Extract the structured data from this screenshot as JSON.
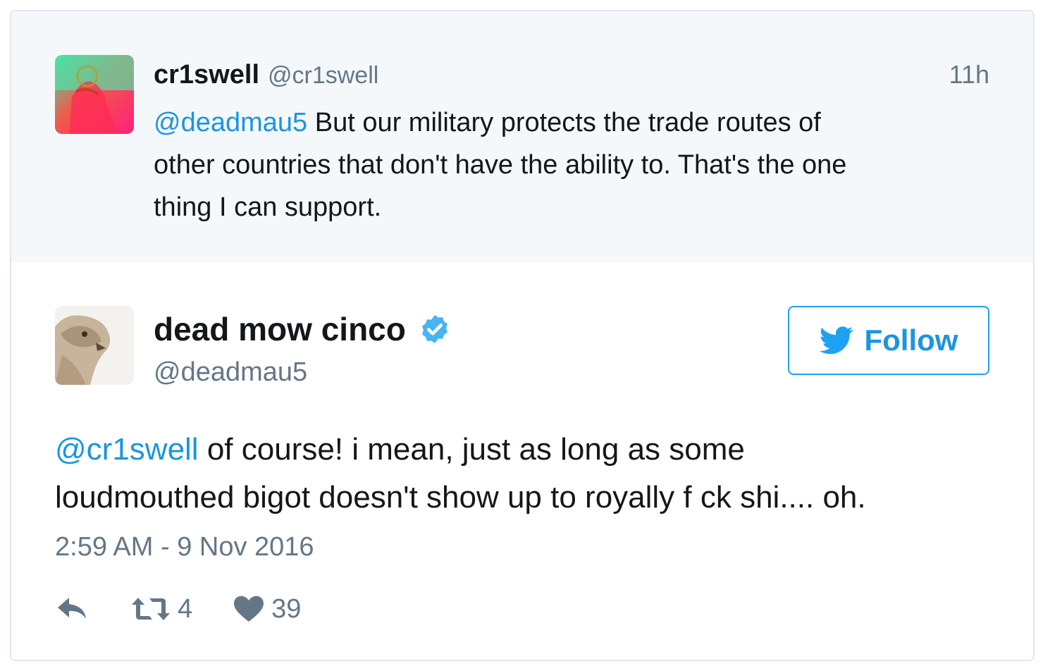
{
  "parent_tweet": {
    "display_name": "cr1swell",
    "handle": "@cr1swell",
    "time": "11h",
    "mention": "@deadmau5",
    "text_line1": " But our military protects the trade routes of",
    "text_line2": "other countries that don't have the ability to. That's the one",
    "text_line3": "thing I can support."
  },
  "tweet": {
    "display_name": "dead mow cinco",
    "handle": "@deadmau5",
    "follow_label": "Follow",
    "mention": "@cr1swell",
    "text_line1": " of course! i mean, just as long as some",
    "text_line2": "loudmouthed bigot doesn't show up to royally f  ck shi.... oh.",
    "date": "2:59 AM - 9 Nov 2016",
    "retweet_count": "4",
    "like_count": "39"
  },
  "colors": {
    "link_blue": "#1b95e0",
    "muted_gray": "#657786",
    "parent_bg": "#f5f8fa",
    "border": "#e1e8ed",
    "verified_blue": "#4ab3f4"
  },
  "icons": [
    "avatar-image",
    "verified-badge-icon",
    "twitter-bird-icon",
    "reply-icon",
    "retweet-icon",
    "heart-icon"
  ]
}
